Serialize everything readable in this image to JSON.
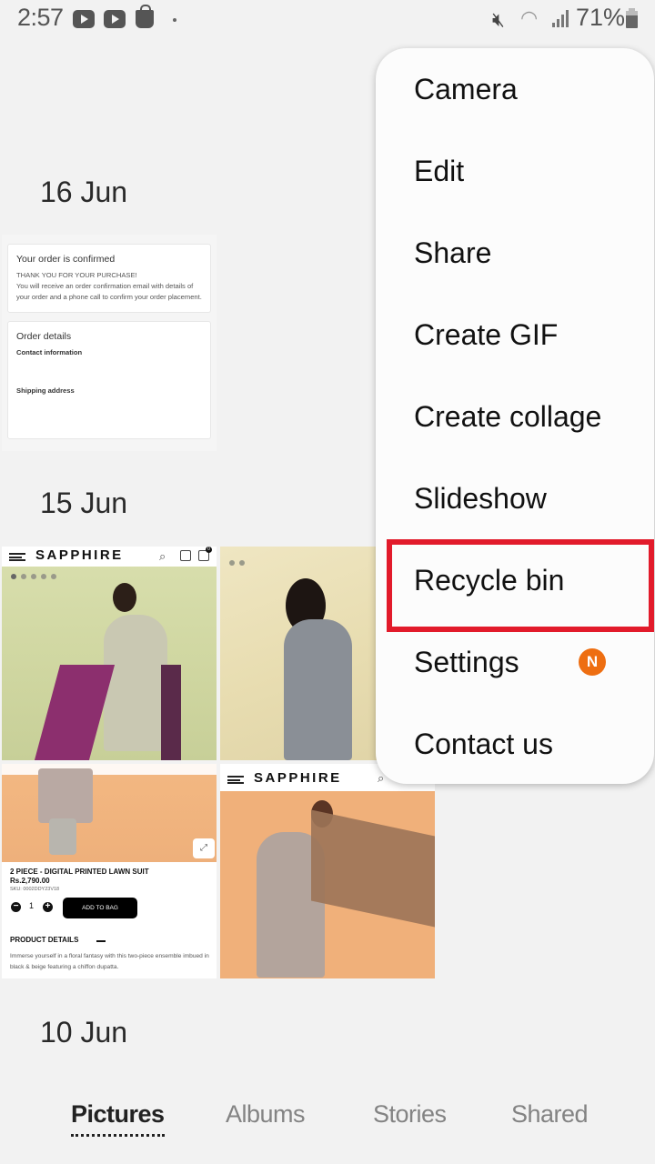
{
  "status_bar": {
    "time": "2:57",
    "notification_icons": [
      "youtube-icon",
      "youtube-icon",
      "shopping-bag-icon",
      "dot-icon"
    ],
    "system_icons": [
      "mute-icon",
      "wifi-icon",
      "signal-icon",
      "battery-icon"
    ],
    "battery_percent": "71%"
  },
  "gallery": {
    "groups": [
      {
        "date": "16 Jun",
        "items": [
          {
            "type": "order-confirmation-screenshot",
            "card1_title": "Your order is confirmed",
            "card1_line1": "THANK YOU FOR YOUR PURCHASE!",
            "card1_line2": "You will receive an order confirmation email with details of your order and a phone call to confirm your order placement.",
            "card2_title": "Order details",
            "card2_label1": "Contact information",
            "card2_label2": "Shipping address"
          }
        ]
      },
      {
        "date": "15 Jun",
        "items": [
          {
            "type": "sapphire-product-screenshot",
            "brand": "SAPPHIRE",
            "cart_count": "0"
          },
          {
            "type": "sapphire-product-photo"
          },
          {
            "type": "sapphire-product-detail-screenshot",
            "brand": "SAPPHIRE",
            "product_title": "2 PIECE - DIGITAL PRINTED LAWN SUIT",
            "price": "Rs.2,790.00",
            "sku": "SKU: 0002DDY23V18",
            "quantity": "1",
            "add_to_bag": "ADD TO BAG",
            "details_heading": "PRODUCT DETAILS",
            "description": "Immerse yourself in a floral fantasy with this two-piece ensemble imbued in black & beige featuring a chiffon dupatta."
          },
          {
            "type": "sapphire-product-screenshot",
            "brand": "SAPPHIRE"
          }
        ]
      },
      {
        "date": "10 Jun",
        "items": []
      }
    ]
  },
  "menu": {
    "items": [
      {
        "label": "Camera"
      },
      {
        "label": "Edit"
      },
      {
        "label": "Share"
      },
      {
        "label": "Create GIF"
      },
      {
        "label": "Create collage"
      },
      {
        "label": "Slideshow"
      },
      {
        "label": "Recycle bin",
        "highlighted": true
      },
      {
        "label": "Settings",
        "badge": "N"
      },
      {
        "label": "Contact us"
      }
    ],
    "highlight_color": "#e21b2b",
    "badge_color": "#ee6e11"
  },
  "bottom_tabs": {
    "active": "Pictures",
    "items": [
      {
        "label": "Pictures"
      },
      {
        "label": "Albums"
      },
      {
        "label": "Stories"
      },
      {
        "label": "Shared"
      }
    ]
  }
}
